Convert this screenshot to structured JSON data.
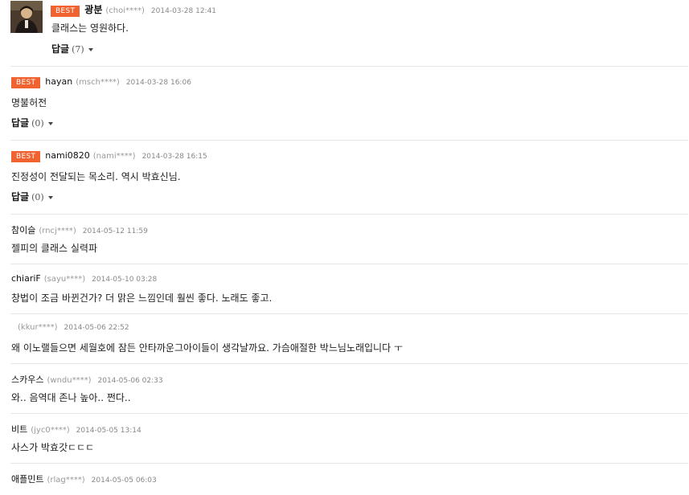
{
  "comments": [
    {
      "best": "BEST",
      "nickname": "광분",
      "user_id": "(choi****)",
      "date": "2014-03-28 12:41",
      "text": "클래스는 영원하다.",
      "reply_label": "답글",
      "reply_count": "(7)"
    },
    {
      "best": "BEST",
      "nickname": "hayan",
      "user_id": "(msch****)",
      "date": "2014-03-28 16:06",
      "text": "명불허전",
      "reply_label": "답글",
      "reply_count": "(0)"
    },
    {
      "best": "BEST",
      "nickname": "nami0820",
      "user_id": "(nami****)",
      "date": "2014-03-28 16:15",
      "text": "진정성이 전달되는 목소리. 역시 박효신님.",
      "reply_label": "답글",
      "reply_count": "(0)"
    },
    {
      "nickname": "참이슬",
      "user_id": "(rncj****)",
      "date": "2014-05-12 11:59",
      "text": "젤피의 클래스 실력파"
    },
    {
      "nickname": "chiariF",
      "user_id": "(sayu****)",
      "date": "2014-05-10 03:28",
      "text": "창법이 조금 바뀐건가? 더 맑은 느낌인데 훨씬 좋다. 노래도 좋고."
    },
    {
      "nickname": "",
      "user_id": "(kkur****)",
      "date": "2014-05-06 22:52",
      "text": "왜 이노랠들으면 세월호에 잠든 안타까운그아이들이 생각날까요. 가슴애절한 박느님노래입니다 ㅜ"
    },
    {
      "nickname": "스카우스",
      "user_id": "(wndu****)",
      "date": "2014-05-06 02:33",
      "text": "와.. 음역대 존나 높아.. 쩐다.."
    },
    {
      "nickname": "비트",
      "user_id": "(jyc0****)",
      "date": "2014-05-05 13:14",
      "text": "사스가 박효갓ㄷㄷㄷ"
    },
    {
      "nickname": "애플민트",
      "user_id": "(rlag****)",
      "date": "2014-05-05 06:03",
      "text": "..."
    }
  ]
}
